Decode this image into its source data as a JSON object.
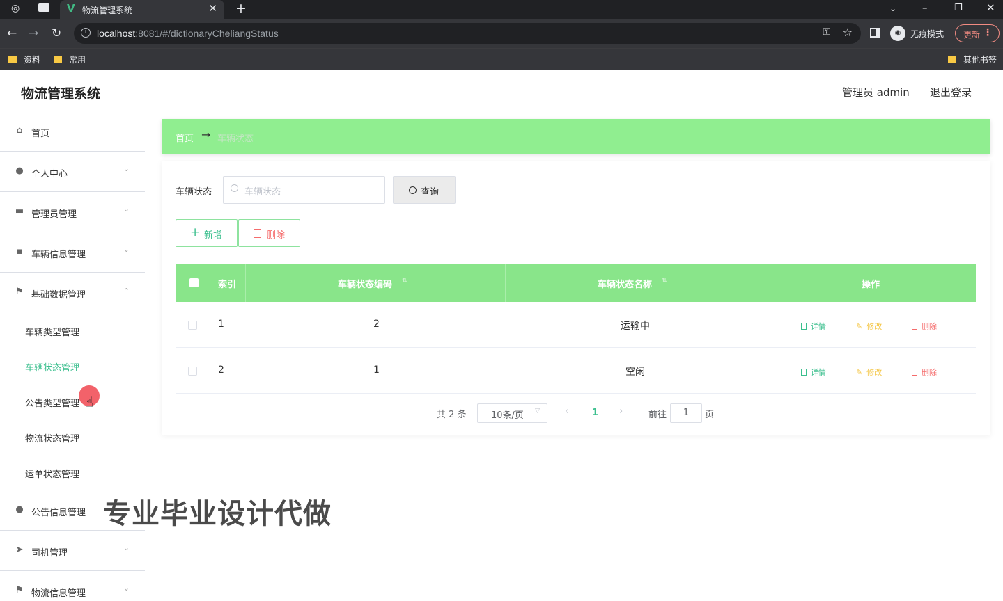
{
  "browser": {
    "tab_title": "物流管理系统",
    "url_host": "localhost",
    "url_rest": ":8081/#/dictionaryCheliangStatus",
    "incognito_label": "无痕模式",
    "update_label": "更新",
    "bookmarks": [
      "资料",
      "常用"
    ],
    "other_bookmarks": "其他书签"
  },
  "app": {
    "title": "物流管理系统",
    "user_label": "管理员 admin",
    "logout_label": "退出登录"
  },
  "sidebar": {
    "items": [
      {
        "label": "首页",
        "icon": "home-icon"
      },
      {
        "label": "个人中心",
        "icon": "user-icon"
      },
      {
        "label": "管理员管理",
        "icon": "briefcase-icon"
      },
      {
        "label": "车辆信息管理",
        "icon": "message-icon"
      },
      {
        "label": "基础数据管理",
        "icon": "flag-icon"
      }
    ],
    "sub_items": [
      "车辆类型管理",
      "车辆状态管理",
      "公告类型管理",
      "物流状态管理",
      "运单状态管理"
    ],
    "more_items": [
      {
        "label": "公告信息管理",
        "icon": "bulb-icon"
      },
      {
        "label": "司机管理",
        "icon": "send-icon"
      },
      {
        "label": "物流信息管理",
        "icon": "flag-icon"
      }
    ]
  },
  "breadcrumb": {
    "home": "首页",
    "arrow": "→",
    "current": "车辆状态"
  },
  "search": {
    "label": "车辆状态",
    "placeholder": "车辆状态",
    "query_label": "查询"
  },
  "toolbar": {
    "add_label": "新增",
    "delete_label": "删除"
  },
  "table": {
    "headers": [
      "索引",
      "车辆状态编码",
      "车辆状态名称",
      "操作"
    ],
    "rows": [
      {
        "index": "1",
        "code": "2",
        "name": "运输中"
      },
      {
        "index": "2",
        "code": "1",
        "name": "空闲"
      }
    ],
    "actions": {
      "detail": "详情",
      "edit": "修改",
      "delete": "删除"
    }
  },
  "pagination": {
    "total": "共 2 条",
    "page_size": "10条/页",
    "current_page": "1",
    "goto_label": "前往",
    "goto_value": "1",
    "page_suffix": "页"
  },
  "watermark": "专业毕业设计代做",
  "colors": {
    "accent": "#90ee90",
    "table_header": "#89e58a",
    "primary_text": "#3bbf8e",
    "danger": "#f56c6c",
    "warning": "#f4c542"
  }
}
